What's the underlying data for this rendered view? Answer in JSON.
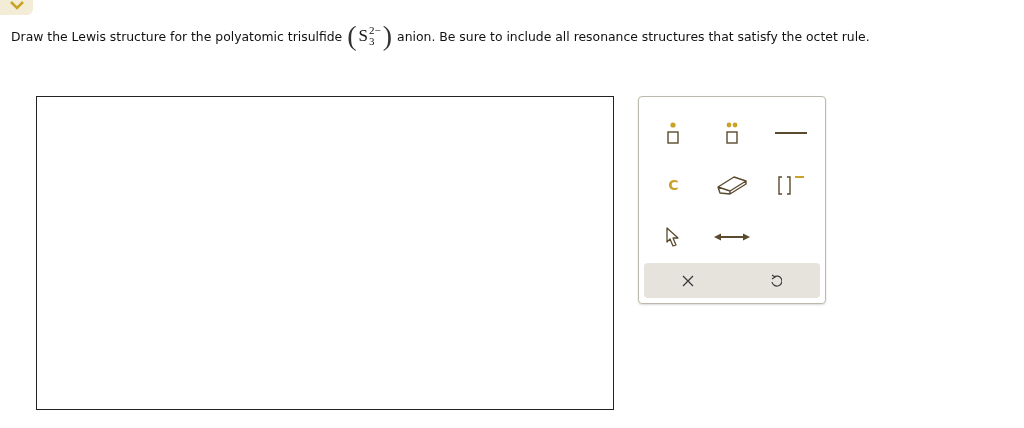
{
  "question": {
    "before": "Draw the Lewis structure for the polyatomic trisulfide",
    "formula": {
      "open": "(",
      "symbol": "S",
      "subscript": "3",
      "superscript": "2−",
      "close": ")"
    },
    "after": "anion. Be sure to include all resonance structures that satisfy the octet rule."
  },
  "tools": [
    {
      "kind": "single-dot"
    },
    {
      "kind": "double-dot"
    },
    {
      "kind": "bond"
    },
    {
      "kind": "atom",
      "label": "C"
    },
    {
      "kind": "eraser"
    },
    {
      "kind": "bracket-charge"
    },
    {
      "kind": "pointer"
    },
    {
      "kind": "arrow"
    }
  ],
  "actions": [
    {
      "kind": "clear"
    },
    {
      "kind": "undo"
    }
  ]
}
